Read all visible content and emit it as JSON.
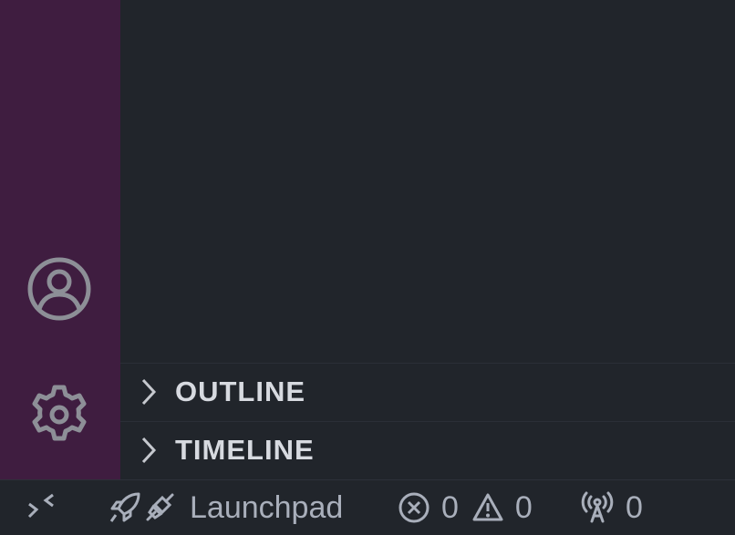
{
  "activity_bar": {
    "background": "#3f1d40",
    "icons": [
      "account-icon",
      "gear-icon"
    ]
  },
  "sidebar": {
    "sections": [
      {
        "label": "OUTLINE",
        "expanded": false
      },
      {
        "label": "TIMELINE",
        "expanded": false
      }
    ]
  },
  "status_bar": {
    "remote_icon": "remote-icon",
    "launchpad": {
      "label": "Launchpad",
      "icons": [
        "rocket-icon",
        "plug-icon"
      ]
    },
    "errors": "0",
    "warnings": "0",
    "ports": "0"
  }
}
